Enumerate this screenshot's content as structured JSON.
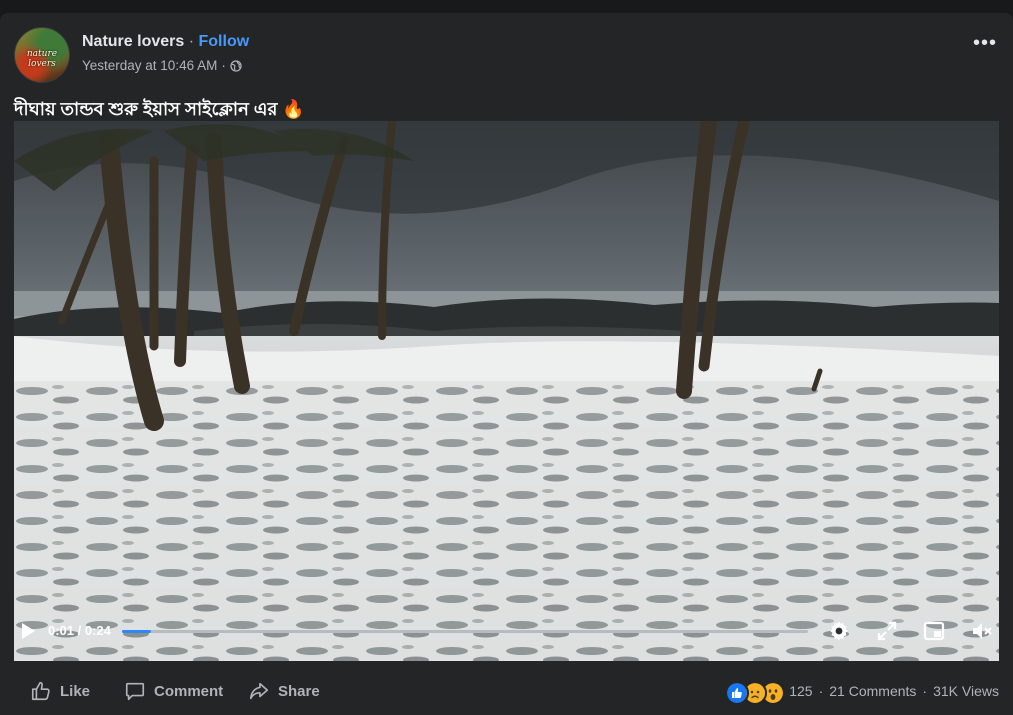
{
  "post": {
    "page_name": "Nature lovers",
    "separator": "·",
    "follow_label": "Follow",
    "timestamp": "Yesterday at 10:46 AM",
    "meta_separator": "·",
    "privacy_icon": "globe-icon",
    "avatar_text": "nature lovers",
    "more_label": "•••",
    "caption": "দীঘায় তান্ডব শুরু ইয়াস সাইক্লোন এর 🔥"
  },
  "video": {
    "current_time": "0:01",
    "time_separator": " / ",
    "duration": "0:24",
    "progress_fraction": 0.042,
    "controls": [
      "play-icon",
      "settings-gear-icon",
      "fullscreen-expand-icon",
      "picture-in-picture-icon",
      "volume-muted-icon"
    ]
  },
  "actions": {
    "like_label": "Like",
    "comment_label": "Comment",
    "share_label": "Share"
  },
  "stats": {
    "reactions": [
      "like",
      "sad",
      "wow"
    ],
    "reaction_count": "125",
    "dot": "·",
    "comments": "21 Comments",
    "views": "31K Views"
  },
  "colors": {
    "background": "#18191a",
    "card": "#242526",
    "accent": "#4599ff",
    "progress": "#2d88ff",
    "secondary_text": "#b0b3b8"
  }
}
